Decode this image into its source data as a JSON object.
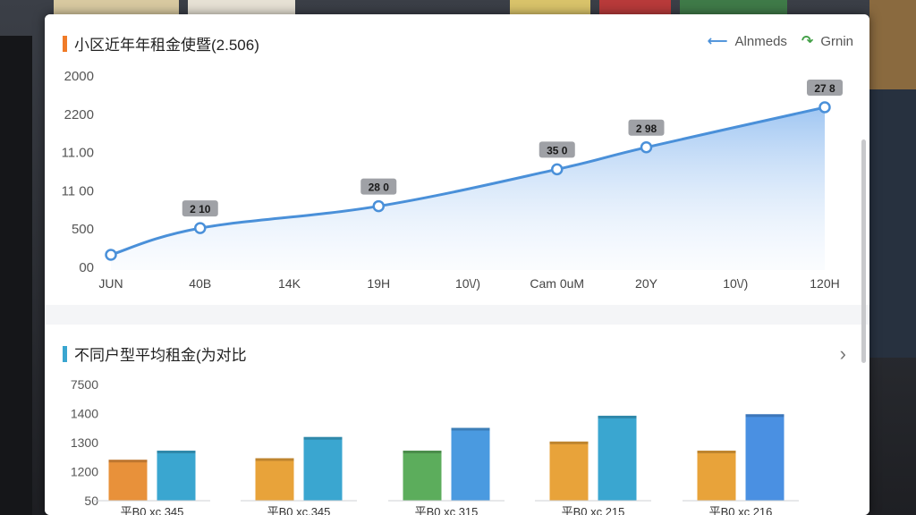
{
  "line_card": {
    "title": "小区近年年租金使暨(2.506)",
    "legend": [
      {
        "label": "Alnmeds",
        "color": "#4a90d9",
        "icon": "arrow-left-icon"
      },
      {
        "label": "Grnin",
        "color": "#43a047",
        "icon": "trend-arrow-icon"
      }
    ]
  },
  "bar_card": {
    "title": "不同户型平均租金(为对比"
  },
  "colors": {
    "line": "#4a90d9",
    "title_bar_top": "#f07b28",
    "title_bar_bottom": "#3aa6d0"
  },
  "chart_data": [
    {
      "type": "area",
      "title": "小区近年年租金使暨(2.506)",
      "y_tick_labels": [
        "2000",
        "2200",
        "11.00",
        "11 00",
        "500",
        "00"
      ],
      "x_tick_labels": [
        "JUN",
        "40B",
        "14K",
        "19H",
        "10\\/)",
        "Cam 0uM",
        "20Y",
        "10\\/)",
        "120H"
      ],
      "points": [
        {
          "x": "JUN",
          "y": 80,
          "label": ""
        },
        {
          "x": "40B",
          "y": 250,
          "label": "2 10"
        },
        {
          "x": "19H",
          "y": 390,
          "label": "28 0"
        },
        {
          "x": "Cam 0uM",
          "y": 625,
          "label": "35 0"
        },
        {
          "x": "20Y",
          "y": 765,
          "label": "2 98"
        },
        {
          "x": "120H",
          "y": 1020,
          "label": "27 8"
        }
      ],
      "grid": false,
      "legend_placement": "top-right"
    },
    {
      "type": "bar",
      "title": "不同户型平均租金(为对比",
      "y_tick_labels": [
        "7500",
        "1400",
        "1300",
        "1200",
        "50"
      ],
      "categories": [
        "平B0 xc 345",
        "平B0 xc.345",
        "平B0 xc 315",
        "平B0 xc 215",
        "平B0 xc 216"
      ],
      "series": [
        {
          "values": [
            1285,
            1290,
            1315,
            1345,
            1315
          ],
          "colors": [
            "#e8913a",
            "#e8a33a",
            "#5cad5c",
            "#e8a33a",
            "#e8a33a"
          ]
        },
        {
          "values": [
            1315,
            1360,
            1390,
            1430,
            1435
          ],
          "colors": [
            "#3aa6d0",
            "#3aa6d0",
            "#4a9ae0",
            "#3aa6d0",
            "#4a90e2"
          ]
        }
      ],
      "grid": false
    }
  ]
}
